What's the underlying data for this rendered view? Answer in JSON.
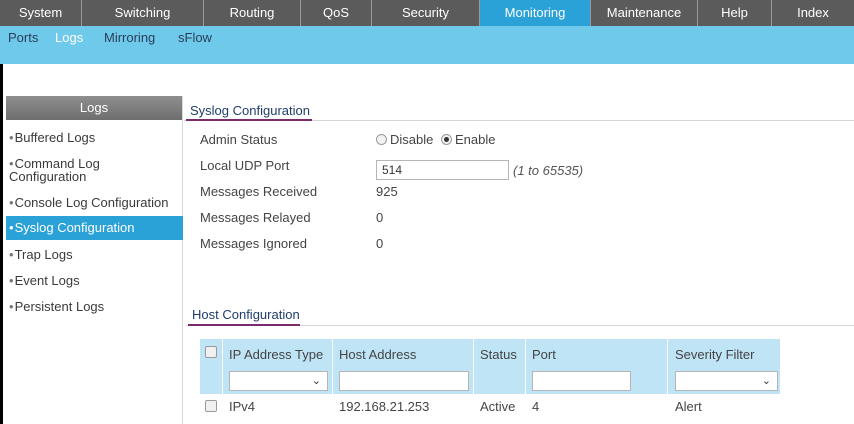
{
  "nav": {
    "tabs": [
      "System",
      "Switching",
      "Routing",
      "QoS",
      "Security",
      "Monitoring",
      "Maintenance",
      "Help",
      "Index"
    ],
    "active": "Monitoring"
  },
  "subnav": {
    "items": [
      "Ports",
      "Logs",
      "Mirroring",
      "sFlow"
    ],
    "active": "Logs"
  },
  "sidebar": {
    "title": "Logs",
    "items": [
      {
        "label": "Buffered Logs"
      },
      {
        "label": "Command Log",
        "label2": "Configuration"
      },
      {
        "label": "Console Log Configuration"
      },
      {
        "label": "Syslog Configuration"
      },
      {
        "label": "Trap Logs"
      },
      {
        "label": "Event Logs"
      },
      {
        "label": "Persistent Logs"
      }
    ],
    "active": "Syslog Configuration"
  },
  "syslog": {
    "title": "Syslog Configuration",
    "admin_status_label": "Admin Status",
    "admin_options": [
      "Disable",
      "Enable"
    ],
    "admin_selected": "Enable",
    "udp_port_label": "Local UDP Port",
    "udp_port_value": "514",
    "udp_port_hint": "(1 to 65535)",
    "received_label": "Messages Received",
    "received_value": "925",
    "relayed_label": "Messages Relayed",
    "relayed_value": "0",
    "ignored_label": "Messages Ignored",
    "ignored_value": "0"
  },
  "host": {
    "title": "Host Configuration",
    "columns": [
      "IP Address Type",
      "Host Address",
      "Status",
      "Port",
      "Severity Filter"
    ],
    "rows": [
      {
        "ip_type": "IPv4",
        "host": "192.168.21.253",
        "status": "Active",
        "port": "4",
        "severity": "Alert"
      }
    ]
  },
  "colors": {
    "nav_bg": "#5b5b5b",
    "nav_active": "#2aa1d7",
    "subnav_bg": "#6fc9eb",
    "table_header": "#bfe4f6",
    "section_underline": "#7a2b6e"
  }
}
